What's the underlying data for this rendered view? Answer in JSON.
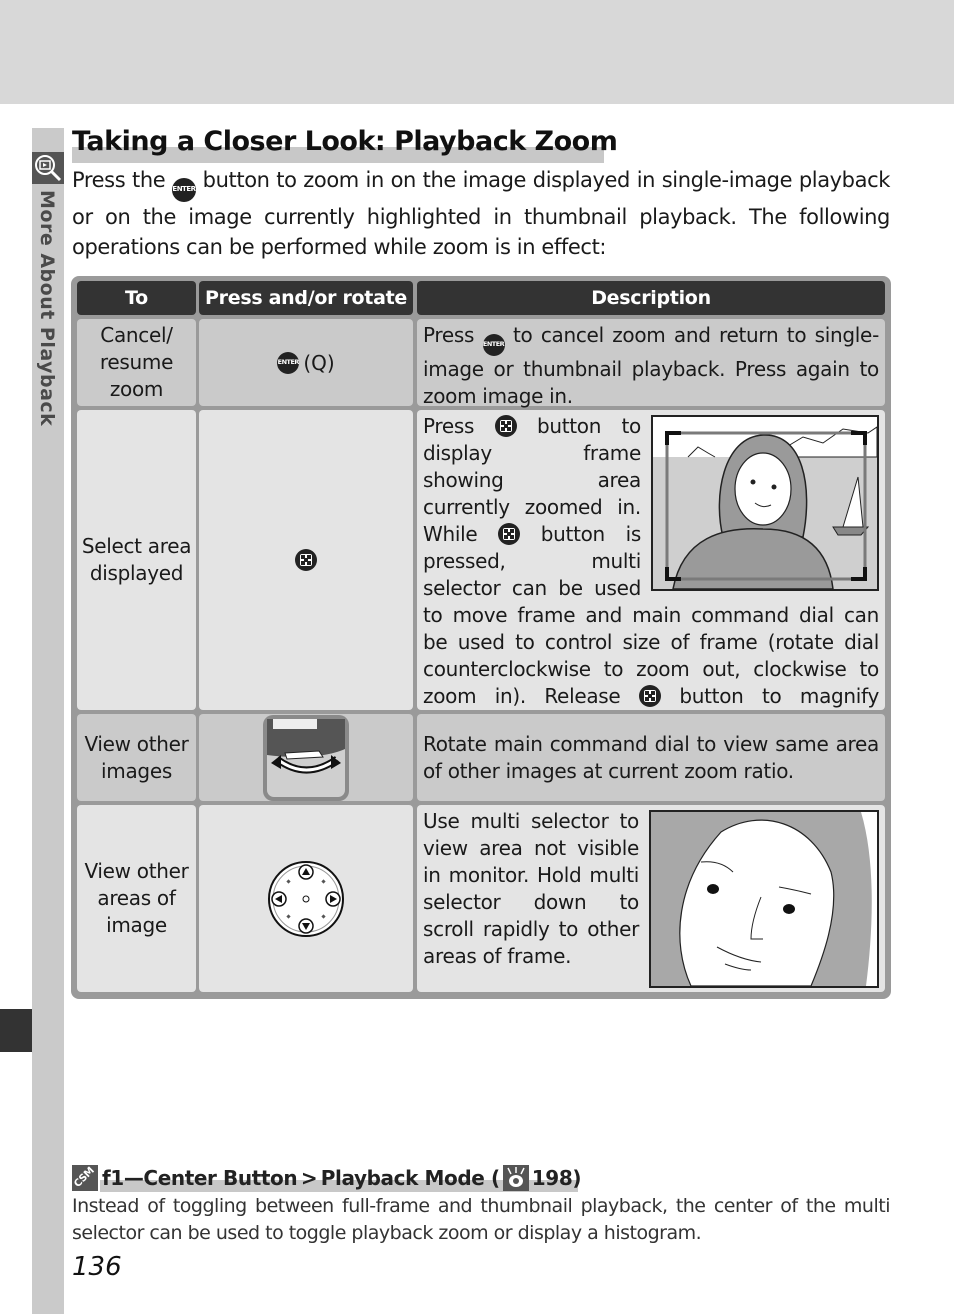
{
  "sidebar": {
    "section_label": "More About Playback",
    "icon": "playback-zoom-icon"
  },
  "page": {
    "title": "Taking a Closer Look: Playback Zoom",
    "intro_before_icon": "Press the",
    "intro_icon": "enter-button-icon",
    "intro_after_icon": " button to zoom in on the image displayed in single-image playback or on the image currently highlighted in thumbnail playback.  The following operations can be performed while zoom is in effect:"
  },
  "table": {
    "headers": [
      "To",
      "Press and/or rotate",
      "Description"
    ],
    "rows": [
      {
        "to": "Cancel/ resume zoom",
        "control_icons": [
          "enter-button-icon",
          "zoom-magnifier-icon"
        ],
        "control_text": "(Q)",
        "description_parts": [
          "Press ",
          " to cancel zoom and return to single-image or thumbnail playback.  Press again to zoom image in."
        ]
      },
      {
        "to": "Select area displayed",
        "control_icons": [
          "center-button-icon"
        ],
        "description_parts": [
          "Press ",
          " button to display frame showing area currently zoomed in.  While ",
          " button is pressed, multi selector can be used to move frame and main command dial can be used to control size of frame (rotate dial counterclockwise to zoom out, clockwise to zoom in).  Release ",
          " button to magnify selected area to fill monitor."
        ],
        "illustration": "zoom-frame-illustration"
      },
      {
        "to": "View other images",
        "control_icons": [
          "main-command-dial-icon"
        ],
        "description": "Rotate main command dial to view same area of other images at current zoom ratio."
      },
      {
        "to": "View other areas of image",
        "control_icons": [
          "multi-selector-icon"
        ],
        "description": "Use multi selector to view area not visible in monitor.  Hold multi selector down to scroll rapidly to other areas of frame.",
        "illustration": "zoomed-face-illustration"
      }
    ]
  },
  "note": {
    "icon": "csm-icon",
    "heading_main": "f1—Center Button > Playback Mode (",
    "ref_icon": "page-reference-icon",
    "heading_ref": " 198)",
    "csm_text": "CSM",
    "body": "Instead of toggling between full-frame and thumbnail playback, the center of the multi selector can be used to toggle playback zoom or display a histogram."
  },
  "footer": {
    "page_number": "136"
  },
  "icons": {
    "enter_label": "ENTER"
  }
}
